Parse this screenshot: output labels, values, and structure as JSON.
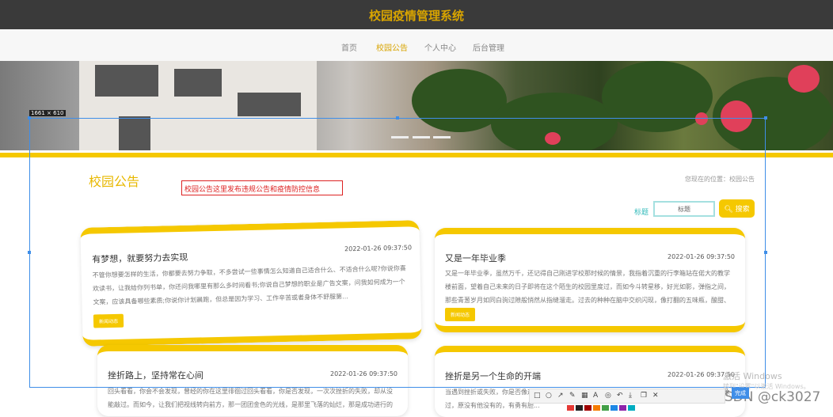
{
  "app": {
    "title": "校园疫情管理系统"
  },
  "nav": {
    "items": [
      "首页",
      "校园公告",
      "个人中心",
      "后台管理"
    ]
  },
  "selection": {
    "size_label": "1661 × 610"
  },
  "section": {
    "title": "校园公告",
    "annotation": "校园公告这里发布违规公告和疫情防控信息",
    "breadcrumb": "您现在的位置：校园公告"
  },
  "search": {
    "label": "标题",
    "placeholder": "标题",
    "button": "搜索",
    "button_icon": "search-icon"
  },
  "cards": [
    {
      "title": "有梦想，就要努力去实现",
      "time": "2022-01-26 09:37:50",
      "body": "不管你想要怎样的生活，你都要去努力争取，不多尝试一些事情怎么知道自己适合什么、不适合什么呢?你说你喜欢读书，让我给你列书单，你还问我哪里有那么多时间看书;你说自己梦想的职业是广告文案，问我如何成为一个文案，应该具备哪些素质;你说你计划晨跑，但总是因为学习、工作辛苦或者身体不舒服第...",
      "tag": "新闻动态"
    },
    {
      "title": "又是一年毕业季",
      "time": "2022-01-26 09:37:50",
      "body": "又是一年毕业季，虽然万千，还记得自己刚进学校那时候的情景，我指着沉重的行李箱站在偌大的教学楼前面，望着自己未来的日子即将在这个陌生的校园里度过，而如今斗转星移，好光如影，弹指之间，那些青葱岁月如同白驹过隙般悄然从指缝溜走。过去的种种在脑中交织闪现，像打翻的五味瓶，酸甜、酸楚...",
      "tag": "新闻动态"
    },
    {
      "title": "挫折路上，坚持常在心间",
      "time": "2022-01-26 09:37:50",
      "body": "回头看看，你会不会发现，曾经的你在这里徘徊过回头看看，你是否发现，一次次挫折的失败，却从没能敲过。而如今，让我们把视线转向前方，那一团团金色的光线，是那里飞落的灿烂，那是成功进行的勒胜。"
    },
    {
      "title": "挫折是另一个生命的开端",
      "time": "2022-01-26 09:37:50",
      "body": "当遇到挫折或失败，你是否像这样的人一样，正视挫折，毫不退缩，努力奋斗，勇敢拼搏！你是否想象过，原没有他没有的，有勇有胆..."
    }
  ],
  "screenshot_tool": {
    "finish_label": "完成",
    "watermark_line1": "激活 Windows",
    "watermark_line2": "转到\"设置\"以激活 Windows。",
    "csdn": "CSDN @ck3027",
    "palette": [
      "#e53935",
      "#222222",
      "#a00000",
      "#f57c00",
      "#43a047",
      "#1e88e5",
      "#8e24aa",
      "#00acc1"
    ],
    "icons": [
      "rect-icon",
      "ellipse-icon",
      "arrow-icon",
      "pen-icon",
      "mosaic-icon",
      "text-icon",
      "pin-icon",
      "undo-icon",
      "save-icon",
      "copy-icon",
      "close-icon"
    ]
  },
  "colors": {
    "accent": "#f5c800",
    "topbar": "#3a3a3a",
    "title": "#d8a400"
  }
}
